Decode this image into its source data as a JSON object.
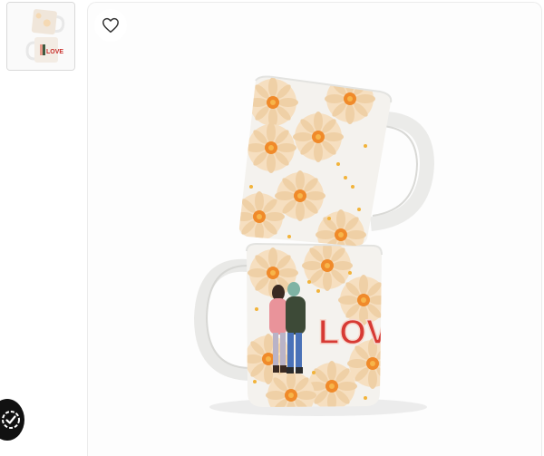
{
  "gallery": {
    "thumbnails": [
      {
        "name": "thumbnail-stacked-mugs",
        "selected": true
      }
    ]
  },
  "viewer": {
    "favorite_icon": "heart-outline-icon",
    "product": {
      "mug_print_text": "LOVE"
    }
  },
  "badge": {
    "icon": "verified-check-icon"
  },
  "colors": {
    "mug_white": "#f3f3f1",
    "petal": "#f6dfc0",
    "petal_dark": "#efcfa5",
    "flower_center": "#f08a2a",
    "dot": "#f2b33a",
    "love_red": "#d73a34",
    "love_outline": "#f6d9cf"
  }
}
